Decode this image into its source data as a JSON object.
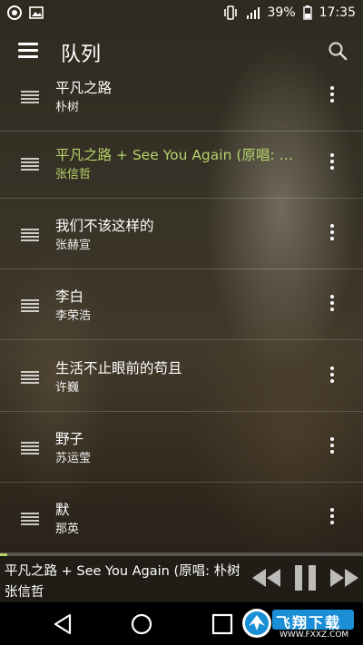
{
  "status_bar": {
    "battery": "39%",
    "time": "17:35",
    "icons": [
      "notification-circle-icon",
      "image-icon",
      "vibrate-icon",
      "signal-icon",
      "battery-icon"
    ]
  },
  "app_bar": {
    "title": "队列",
    "icons": [
      "menu-icon",
      "search-icon"
    ]
  },
  "queue": [
    {
      "title": "平凡之路",
      "artist": "朴树",
      "active": false
    },
    {
      "title": "平凡之路 + See You Again (原唱: 朴…",
      "artist": "张信哲",
      "active": true
    },
    {
      "title": "我们不该这样的",
      "artist": "张赫宣",
      "active": false
    },
    {
      "title": "李白",
      "artist": "李荣浩",
      "active": false
    },
    {
      "title": "生活不止眼前的苟且",
      "artist": "许巍",
      "active": false
    },
    {
      "title": "野子",
      "artist": "苏运莹",
      "active": false
    },
    {
      "title": "默",
      "artist": "那英",
      "active": false
    }
  ],
  "now_playing": {
    "title": "平凡之路 + See You Again (原唱: 朴树 /",
    "artist": "张信哲",
    "progress": 0.02,
    "controls": [
      "rewind-icon",
      "pause-icon",
      "fast-forward-icon"
    ]
  },
  "nav_bar": {
    "icons": [
      "back-icon",
      "home-icon",
      "recents-icon"
    ]
  },
  "watermark": {
    "text": "飞翔下载",
    "url": "WWW.FXXZ.COM"
  },
  "colors": {
    "accent": "#b6d36b",
    "watermark_blue": "#1a8fd6"
  }
}
